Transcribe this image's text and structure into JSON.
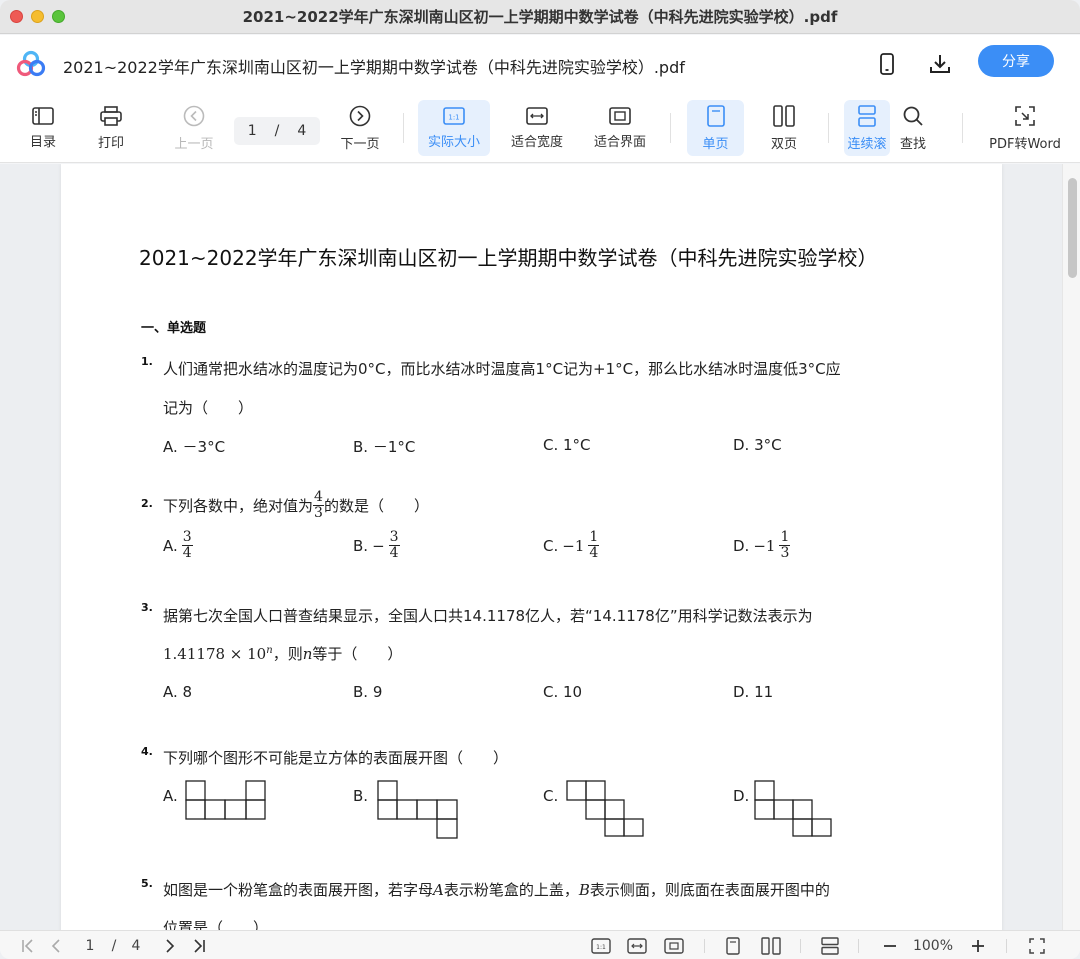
{
  "window": {
    "title": "2021~2022学年广东深圳南山区初一上学期期中数学试卷（中科先进院实验学校）.pdf"
  },
  "header": {
    "doc_title": "2021~2022学年广东深圳南山区初一上学期期中数学试卷（中科先进院实验学校）.pdf",
    "share_label": "分享"
  },
  "toolbar": {
    "toc": "目录",
    "print": "打印",
    "prev": "上一页",
    "page_current": "1",
    "page_sep": "/",
    "page_total": "4",
    "next": "下一页",
    "actual_size": "实际大小",
    "fit_width": "适合宽度",
    "fit_page": "适合界面",
    "single": "单页",
    "double": "双页",
    "continuous": "连续滚",
    "find": "查找",
    "pdf_word": "PDF转Word",
    "accent": "#3b8ef6"
  },
  "paper": {
    "title": "2021~2022学年广东深圳南山区初一上学期期中数学试卷（中科先进院实验学校）",
    "section": "一、单选题",
    "q1": {
      "num": "1.",
      "line1": "人们通常把水结冰的温度记为0°C，而比水结冰时温度高1°C记为+1°C，那么比水结冰时温度低3°C应",
      "line2": "记为（　　）",
      "a": "A. －3°C",
      "b": "B. －1°C",
      "c": "C. 1°C",
      "d": "D. 3°C"
    },
    "q2": {
      "num": "2.",
      "pre": "下列各数中，绝对值为",
      "frac_n": "4",
      "frac_d": "3",
      "post": "的数是（　　）",
      "a_label": "A.",
      "a_n": "3",
      "a_d": "4",
      "b_label": "B.",
      "b_sign": "−",
      "b_n": "3",
      "b_d": "4",
      "c_label": "C.",
      "c_whole": "−1",
      "c_n": "1",
      "c_d": "4",
      "d_label": "D.",
      "d_whole": "−1",
      "d_n": "1",
      "d_d": "3"
    },
    "q3": {
      "num": "3.",
      "line1": "据第七次全国人口普查结果显示，全国人口共14.1178亿人，若“14.1178亿”用科学记数法表示为",
      "math": "1.41178 × 10",
      "exp": "n",
      "line2_mid": "，则",
      "var": "n",
      "line2_post": "等于（　　）",
      "a": "A. 8",
      "b": "B. 9",
      "c": "C. 10",
      "d": "D. 11"
    },
    "q4": {
      "num": "4.",
      "line1": "下列哪个图形不可能是立方体的表面展开图（　　）",
      "a": "A.",
      "b": "B.",
      "c": "C.",
      "d": "D."
    },
    "q5": {
      "num": "5.",
      "line1_pre": "如图是一个粉笔盒的表面展开图，若字母",
      "var_a": "A",
      "line1_mid": "表示粉笔盒的上盖，",
      "var_b": "B",
      "line1_post": "表示侧面，则底面在表面展开图中的",
      "line2": "位置是（　　）"
    }
  },
  "statusbar": {
    "page_current": "1",
    "page_sep": "/",
    "page_total": "4",
    "zoom": "100%"
  }
}
